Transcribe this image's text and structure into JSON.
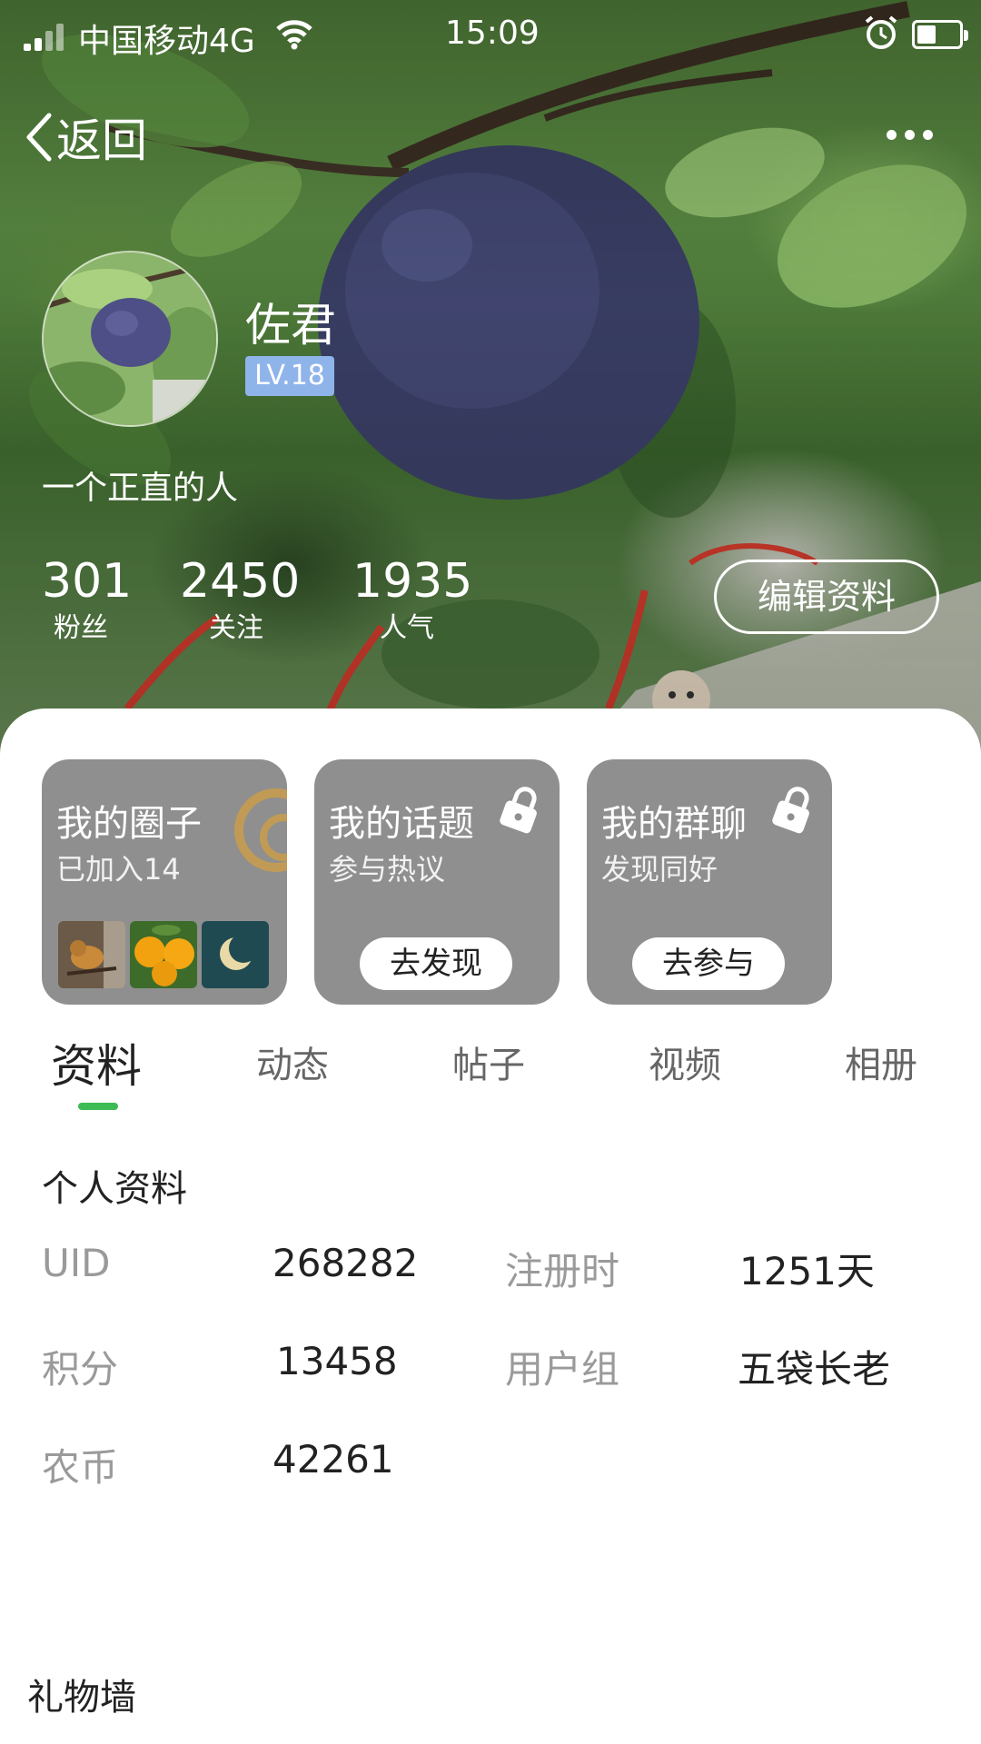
{
  "status_bar": {
    "carrier": "中国移动4G",
    "time": "15:09",
    "battery_level": 0.45,
    "icons": [
      "signal-icon",
      "wifi-icon",
      "alarm-icon",
      "battery-icon"
    ]
  },
  "nav": {
    "back_label": "返回",
    "back_icon": "chevron-left-icon",
    "more_icon": "more-icon"
  },
  "profile": {
    "nickname": "佐君",
    "level": "LV.18",
    "bio": "一个正直的人",
    "edit_label": "编辑资料",
    "stats": [
      {
        "value": "301",
        "label": "粉丝"
      },
      {
        "value": "2450",
        "label": "关注"
      },
      {
        "value": "1935",
        "label": "人气"
      }
    ]
  },
  "cards": [
    {
      "title": "我的圈子",
      "subtitle": "已加入14"
    },
    {
      "title": "我的话题",
      "subtitle": "参与热议",
      "button": "去发现",
      "icon": "lock-icon"
    },
    {
      "title": "我的群聊",
      "subtitle": "发现同好",
      "button": "去参与",
      "icon": "lock-icon"
    }
  ],
  "tabs": {
    "items": [
      "资料",
      "动态",
      "帖子",
      "视频",
      "相册"
    ],
    "active_index": 0,
    "indicator_color": "#3dbb55"
  },
  "info": {
    "title": "个人资料",
    "rows": [
      {
        "label": "UID",
        "value": "268282"
      },
      {
        "label": "注册时",
        "value": "1251天"
      },
      {
        "label": "积分",
        "value": "13458"
      },
      {
        "label": "用户组",
        "value": "五袋长老"
      },
      {
        "label": "农币",
        "value": "42261"
      }
    ]
  },
  "gift_wall": {
    "title": "礼物墙"
  },
  "colors": {
    "level_badge": "#8fb4ea",
    "card_bg": "#8f8f8f",
    "accent": "#3dbb55"
  }
}
